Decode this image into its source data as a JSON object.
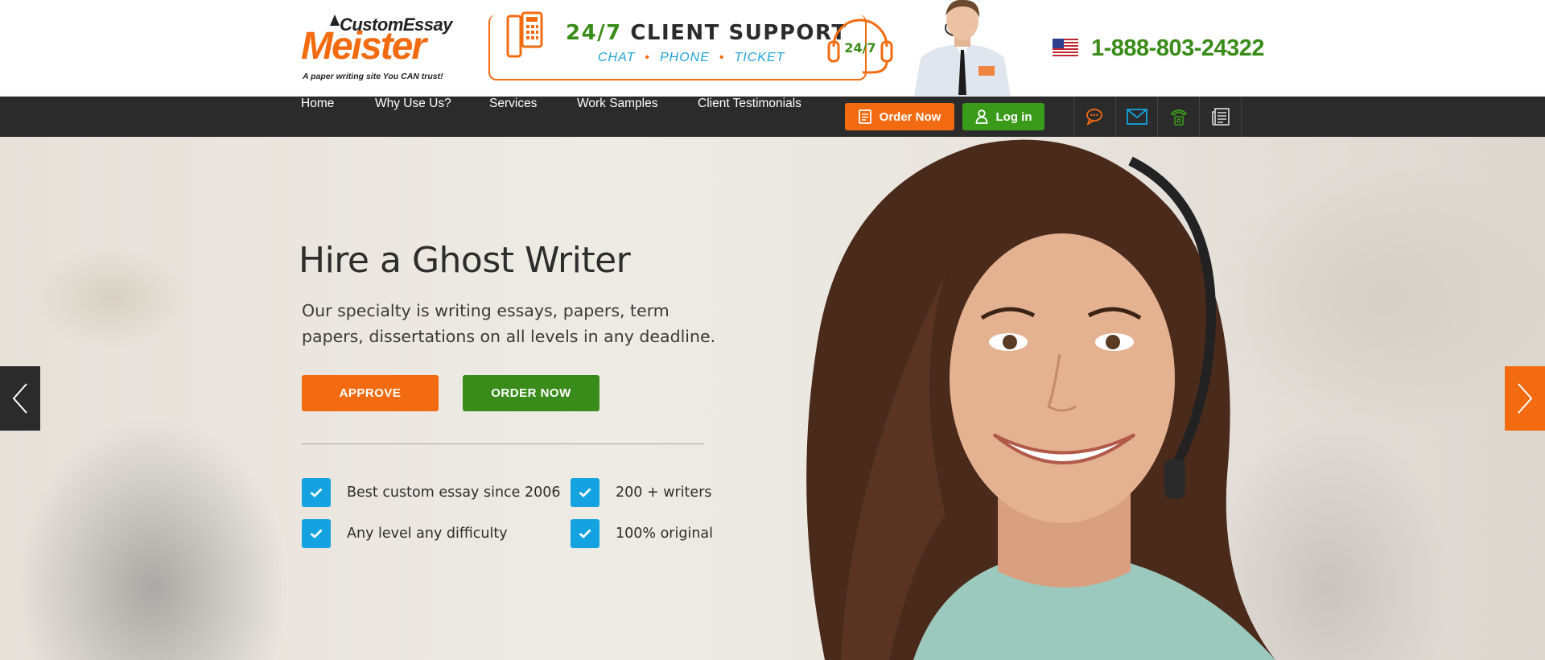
{
  "header": {
    "logo": {
      "top_text": "CustomEssay",
      "main_text": "Meister",
      "tagline": "A paper writing site You CAN trust!"
    },
    "support": {
      "title_highlight": "24/7",
      "title_rest": "CLIENT SUPPORT",
      "channels": [
        "CHAT",
        "PHONE",
        "TICKET"
      ],
      "badge": "24/7"
    },
    "phone": {
      "flag_icon": "us-flag-icon",
      "number": "1-888-803-24322"
    }
  },
  "nav": {
    "items": [
      "Home",
      "Why Use Us?",
      "Services",
      "Work Samples",
      "Client Testimonials"
    ],
    "order_button": "Order Now",
    "login_button": "Log in",
    "icons": [
      "chat-icon",
      "email-icon",
      "phone-icon",
      "news-icon"
    ]
  },
  "hero": {
    "title": "Hire a Ghost Writer",
    "description": "Our specialty is writing essays, papers, term papers, dissertations on all levels in any deadline.",
    "approve_button": "APPROVE",
    "order_button": "ORDER NOW",
    "features": [
      "Best custom essay since 2006",
      "200 + writers",
      "Any level any difficulty",
      "100% original"
    ]
  },
  "colors": {
    "accent_orange": "#f26b11",
    "accent_green": "#3a8c1a",
    "nav_bg": "#2b2b2b",
    "check_blue": "#14a3e0"
  }
}
